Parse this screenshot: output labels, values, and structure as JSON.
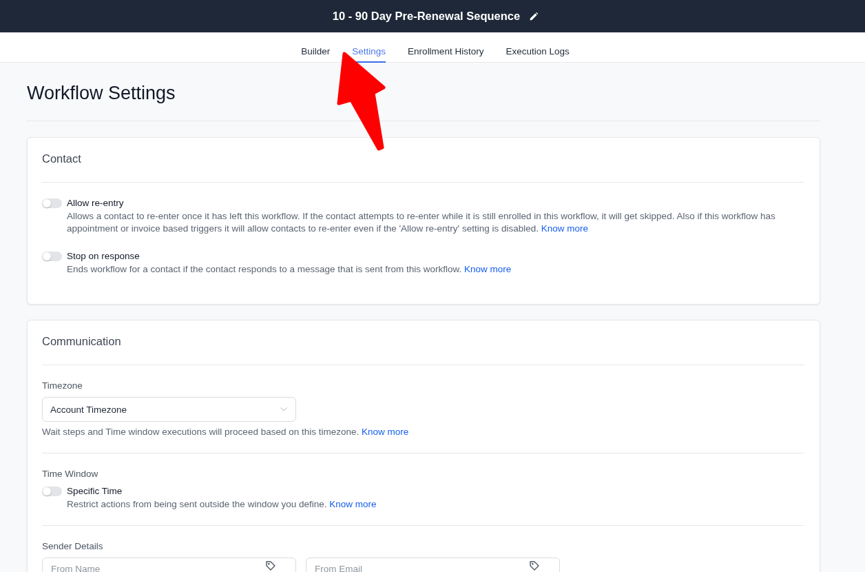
{
  "header": {
    "title": "10 - 90 Day Pre-Renewal Sequence"
  },
  "tabs": [
    {
      "label": "Builder",
      "selected": false
    },
    {
      "label": "Settings",
      "selected": true
    },
    {
      "label": "Enrollment History",
      "selected": false
    },
    {
      "label": "Execution Logs",
      "selected": false
    }
  ],
  "page_title": "Workflow Settings",
  "sections": [
    {
      "title": "Contact",
      "groups": [
        {
          "items": [
            {
              "kind": "toggle",
              "label": "Allow re-entry",
              "on": false,
              "description": "Allows a contact to re-enter once it has left this workflow. If the contact attempts to re-enter while it is still enrolled in this workflow, it will get skipped. Also if this workflow has appointment or invoice based triggers it will allow contacts to re-enter even if the 'Allow re-entry' setting is disabled.",
              "link": "Know more"
            },
            {
              "kind": "toggle",
              "label": "Stop on response",
              "on": false,
              "description": "Ends workflow for a contact if the contact responds to a message that is sent from this workflow.",
              "link": "Know more"
            }
          ]
        }
      ]
    },
    {
      "title": "Communication",
      "groups": [
        {
          "label": "Timezone",
          "items": [
            {
              "kind": "select",
              "value": "Account Timezone",
              "description": "Wait steps and Time window executions will proceed based on this timezone.",
              "link": "Know more"
            }
          ]
        },
        {
          "label": "Time Window",
          "items": [
            {
              "kind": "toggle",
              "label": "Specific Time",
              "on": false,
              "description": "Restrict actions from being sent outside the window you define.",
              "link": "Know more"
            }
          ]
        },
        {
          "label": "Sender Details",
          "items": [
            {
              "kind": "input",
              "placeholder": "From Name"
            },
            {
              "kind": "input",
              "placeholder": "From Email"
            }
          ]
        }
      ]
    }
  ]
}
